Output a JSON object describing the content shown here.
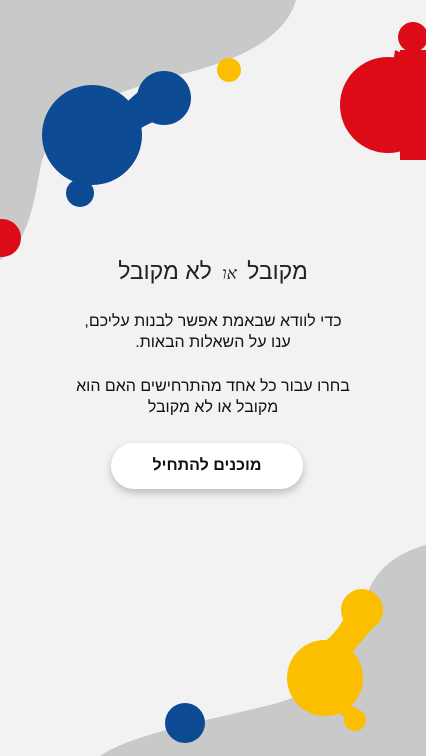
{
  "title": {
    "left_word": "מקובל",
    "separator": "או",
    "right_words": "לא מקובל"
  },
  "intro": {
    "line1": "כדי לוודא שבאמת אפשר לבנות עליכם,",
    "line2": "ענו על השאלות הבאות."
  },
  "instructions": {
    "line1": "בחרו עבור כל אחד מהתרחישים האם הוא",
    "line2": "מקובל או לא מקובל"
  },
  "start_button": {
    "label": "מוכנים להתחיל"
  },
  "colors": {
    "background": "#f2f2f2",
    "gray_blob": "#c9c9c9",
    "blue": "#0d4a94",
    "red": "#dc0b17",
    "yellow": "#fbbf00"
  }
}
